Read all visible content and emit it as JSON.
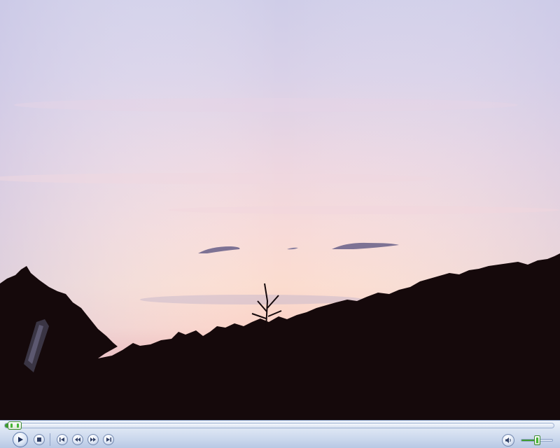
{
  "player": {
    "seek_progress": 0.013,
    "volume_level": 0.5,
    "controls": {
      "play_icon": "play-icon",
      "stop_icon": "stop-icon",
      "previous_icon": "previous-track-icon",
      "rewind_icon": "rewind-icon",
      "fast_forward_icon": "fast-forward-icon",
      "next_icon": "next-track-icon",
      "mute_icon": "speaker-icon"
    },
    "colors": {
      "control_bar": "#c9d6ec",
      "progress_accent": "#3e9b2f"
    }
  },
  "video_frame": {
    "scene": "sunset-sky-treeline",
    "sky_top": "#c8c9e8",
    "sky_middle": "#f4dad9",
    "sky_horizon": "#fcc9b7",
    "silhouette": "#15090b"
  }
}
